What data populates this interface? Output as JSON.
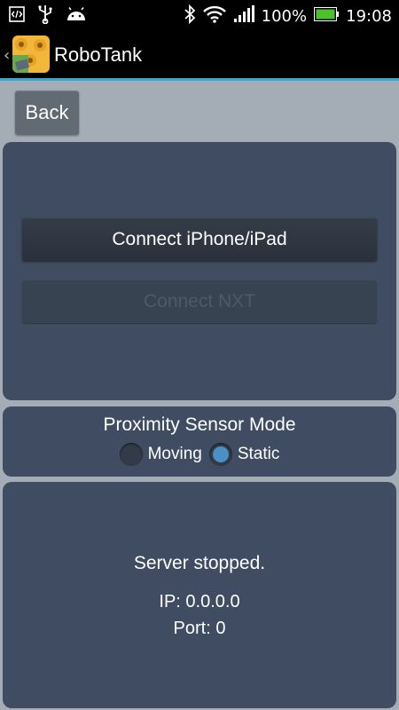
{
  "status_bar": {
    "battery_percent": "100%",
    "time": "19:08",
    "icons": [
      "debug-icon",
      "usb-icon",
      "android-icon",
      "bluetooth-icon",
      "wifi-icon",
      "signal-icon",
      "battery-icon"
    ]
  },
  "action_bar": {
    "title": "RoboTank"
  },
  "back_button": {
    "label": "Back"
  },
  "connect_panel": {
    "connect_ios_label": "Connect iPhone/iPad",
    "connect_nxt_label": "Connect NXT"
  },
  "proximity": {
    "title": "Proximity Sensor Mode",
    "options": [
      {
        "label": "Moving",
        "selected": false
      },
      {
        "label": "Static",
        "selected": true
      }
    ]
  },
  "server": {
    "status": "Server stopped.",
    "ip": "IP: 0.0.0.0",
    "port": "Port: 0"
  },
  "colors": {
    "accent": "#3aa6d0",
    "panel": "#3f4c61",
    "background": "#a4acb6",
    "radio_selected": "#4a90c4"
  }
}
